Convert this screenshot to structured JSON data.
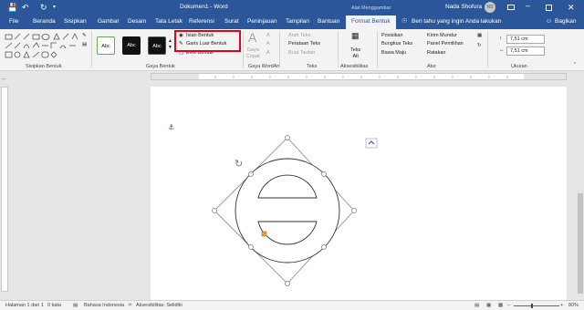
{
  "titlebar": {
    "title": "Dokumen1 - Word",
    "drawing_tools": "Alat Menggambar",
    "user_name": "Nada Shofura",
    "user_initials": "NS"
  },
  "tabs": [
    "File",
    "Beranda",
    "Sisipkan",
    "Gambar",
    "Desain",
    "Tata Letak",
    "Referensi",
    "Surat",
    "Peninjauan",
    "Tampilan",
    "Bantuan",
    "Format Bentuk"
  ],
  "tell_me": "Beri tahu yang ingin Anda lakukan",
  "share": "Bagikan",
  "ribbon": {
    "insert_shapes_label": "Sisipkan Bentuk",
    "shape_styles_label": "Gaya Bentuk",
    "style_sample": "Abc",
    "shape_fill": "Isian Bentuk",
    "shape_outline": "Garis Luar Bentuk",
    "shape_effects": "Efek Bentuk",
    "quick_styles": "Gaya\nCepat",
    "wordart_label": "Gaya WordArt",
    "text_direction": "Arah Teks",
    "align_text": "Perataan Teks",
    "create_link": "Buat Tautan",
    "text_label": "Teks",
    "alt_text": "Teks\nAlt",
    "accessibility_label": "Aksesibilitas",
    "position": "Posisikan",
    "wrap_text": "Bungkus Teks",
    "bring_forward": "Bawa Maju",
    "send_backward": "Kirim Mundur",
    "selection_pane": "Panel Pemilihan",
    "align": "Ratakan",
    "arrange_label": "Atur",
    "height": "7,51 cm",
    "width": "7,51 cm",
    "size_label": "Ukuran"
  },
  "status": {
    "page": "Halaman 1 dari 1",
    "words": "0 kata",
    "language": "Bahasa Indonesia",
    "accessibility": "Aksesibilitas: Selidiki",
    "zoom": "80%"
  },
  "colors": {
    "word_blue": "#2b579a",
    "highlight_red": "#e3001b",
    "handle_orange": "#f0a020"
  }
}
